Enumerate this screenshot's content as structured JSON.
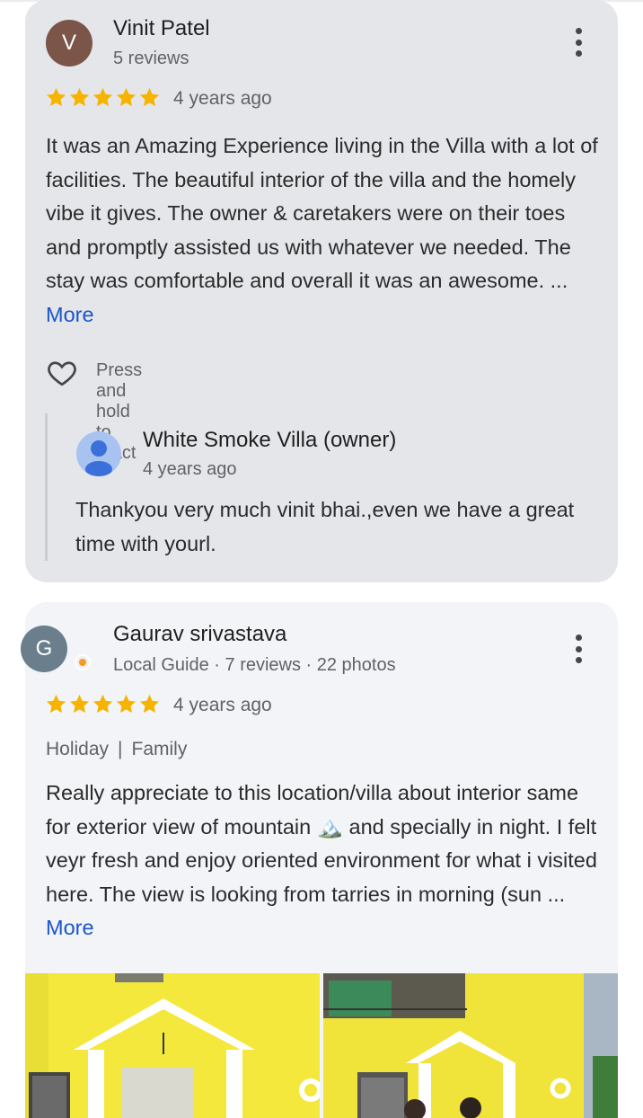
{
  "review1": {
    "avatar_letter": "V",
    "author": "Vinit Patel",
    "meta": "5 reviews",
    "rating": 5,
    "time": "4 years ago",
    "text": "It was an Amazing Experience living in the Villa with a lot of facilities. The beautiful interior of the villa and the homely vibe it gives. The owner & caretakers were on their toes and promptly assisted us with whatever we needed. The stay was comfortable and overall it was an awesome. ...",
    "more": "More",
    "react_label": "Press and hold to react",
    "owner_reply": {
      "name": "White Smoke Villa (owner)",
      "time": "4 years ago",
      "text": "Thankyou very much vinit bhai.,even we have a great time with yourl."
    }
  },
  "review2": {
    "avatar_letter": "G",
    "author": "Gaurav srivastava",
    "meta": "Local Guide · 7 reviews · 22 photos",
    "rating": 5,
    "time": "4 years ago",
    "tag1": "Holiday",
    "tag_sep": "|",
    "tag2": "Family",
    "text_part1": "Really appreciate to this location/villa about interior same for exterior view of mountain",
    "emoji": "🏔️",
    "text_part2": "and specially in night. I felt veyr fresh and enjoy oriented environment for what i visited here. The view is looking from tarries in morning (sun ...",
    "more": "More"
  },
  "colors": {
    "star": "#f6b400",
    "link": "#1a56c9",
    "card1_bg": "#e4e6ea",
    "card2_bg": "#f2f4f7"
  }
}
